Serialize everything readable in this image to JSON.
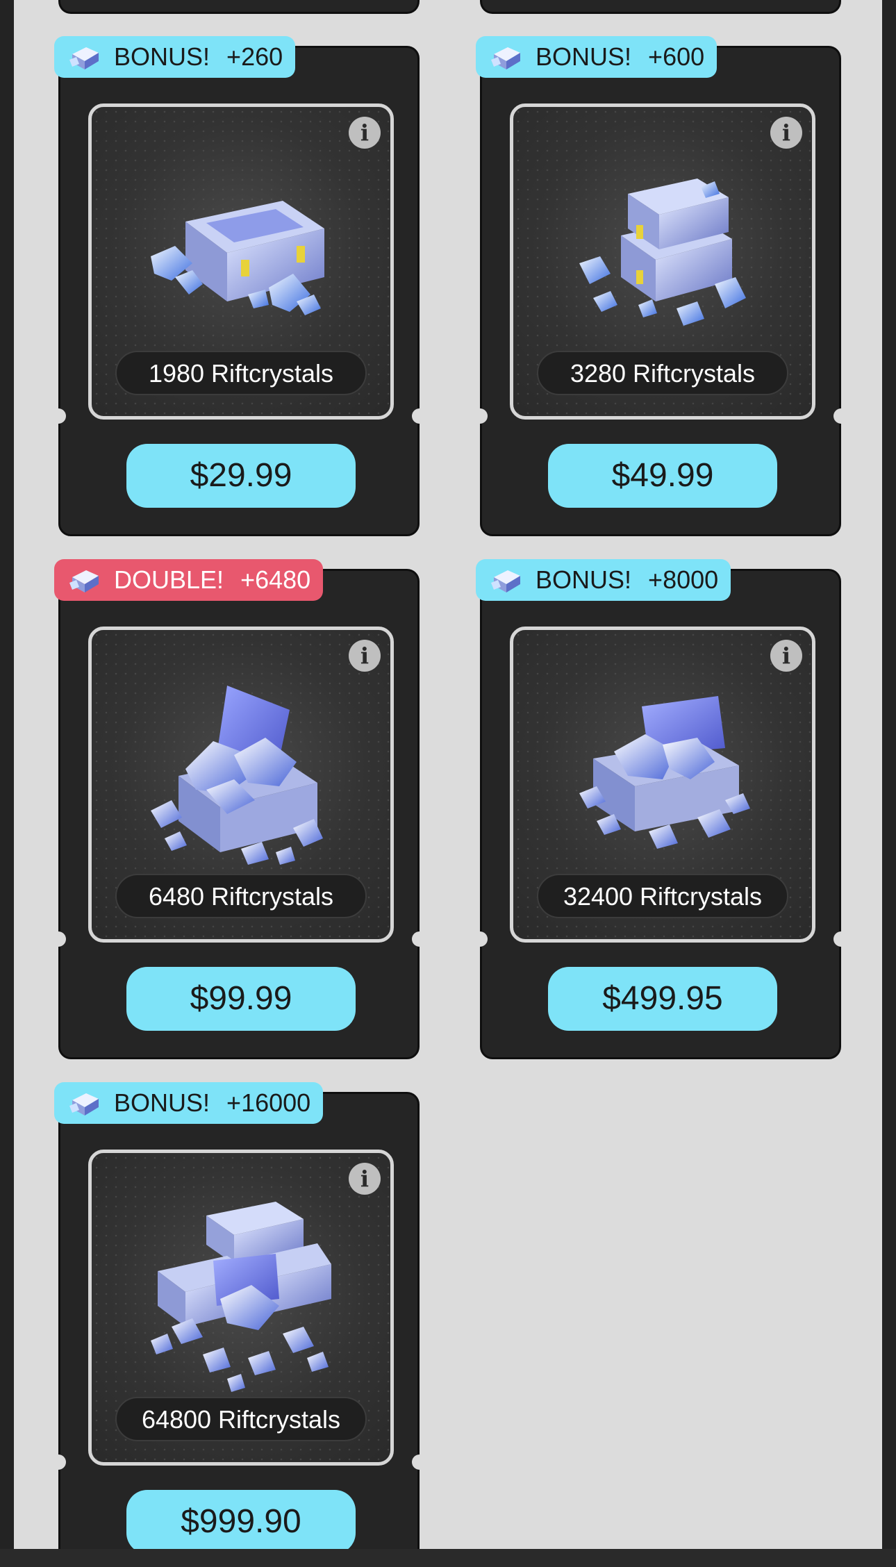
{
  "packs": [
    {
      "badge_type": "bonus",
      "badge_label": "BONUS!",
      "badge_amount": "+260",
      "name": "1980 Riftcrystals",
      "price": "$29.99",
      "art": "single-crate-icon"
    },
    {
      "badge_type": "bonus",
      "badge_label": "BONUS!",
      "badge_amount": "+600",
      "name": "3280 Riftcrystals",
      "price": "$49.99",
      "art": "stacked-crates-icon"
    },
    {
      "badge_type": "double",
      "badge_label": "DOUBLE!",
      "badge_amount": "+6480",
      "name": "6480 Riftcrystals",
      "price": "$99.99",
      "art": "open-crate-icon"
    },
    {
      "badge_type": "bonus",
      "badge_label": "BONUS!",
      "badge_amount": "+8000",
      "name": "32400 Riftcrystals",
      "price": "$499.95",
      "art": "wide-open-crate-icon"
    },
    {
      "badge_type": "bonus",
      "badge_label": "BONUS!",
      "badge_amount": "+16000",
      "name": "64800 Riftcrystals",
      "price": "$999.90",
      "art": "crate-pile-icon"
    }
  ],
  "info_glyph": "i",
  "colors": {
    "bonus_badge": "#7ee3f8",
    "double_badge": "#e8586e",
    "price_button": "#7ee3f8",
    "card_background": "#252525",
    "page_background": "#dcdcdc"
  }
}
